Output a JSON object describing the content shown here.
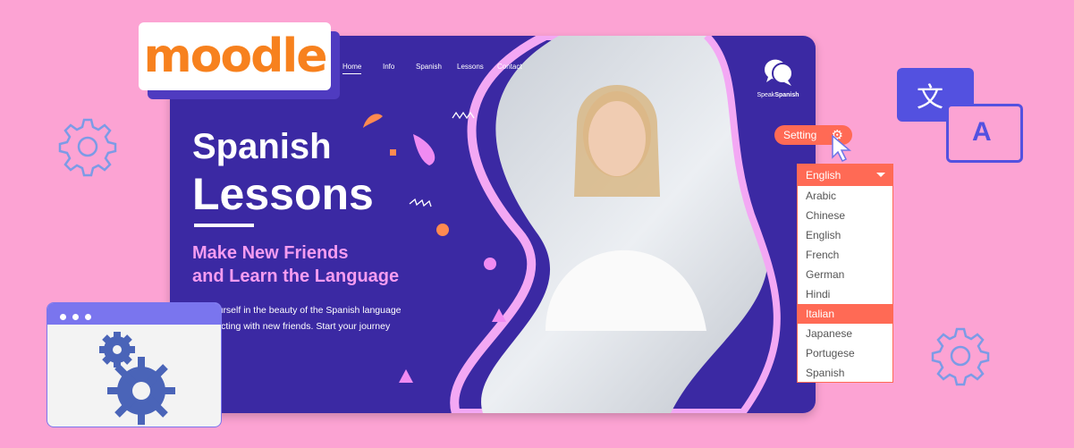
{
  "brand": {
    "logo": "moodle",
    "site_name_a": "Speak",
    "site_name_b": "Spanish"
  },
  "nav": {
    "items": [
      "Home",
      "Info",
      "Spanish",
      "Lessons",
      "Contact"
    ],
    "active": "Home"
  },
  "hero": {
    "title_line1": "Spanish",
    "title_line2": "Lessons",
    "subtitle_line1": "Make New Friends",
    "subtitle_line2": "and Learn the Language",
    "body_line1": "...e yourself in the beauty of the Spanish language",
    "body_line2": "...onnecting with new friends. Start your journey"
  },
  "settings": {
    "label": "Setting",
    "icon": "gear-icon"
  },
  "language_dropdown": {
    "selected": "English",
    "highlighted": "Italian",
    "options": [
      "Arabic",
      "Chinese",
      "English",
      "French",
      "German",
      "Hindi",
      "Italian",
      "Japanese",
      "Portugese",
      "Spanish"
    ]
  },
  "translate_icon": {
    "glyph_a": "文",
    "glyph_b": "A"
  },
  "colors": {
    "background": "#fca3d3",
    "card": "#3b29a3",
    "accent": "#ff6a55",
    "pink": "#f59cf0",
    "moodle_orange": "#f7811e",
    "icon_blue": "#5351e0"
  }
}
